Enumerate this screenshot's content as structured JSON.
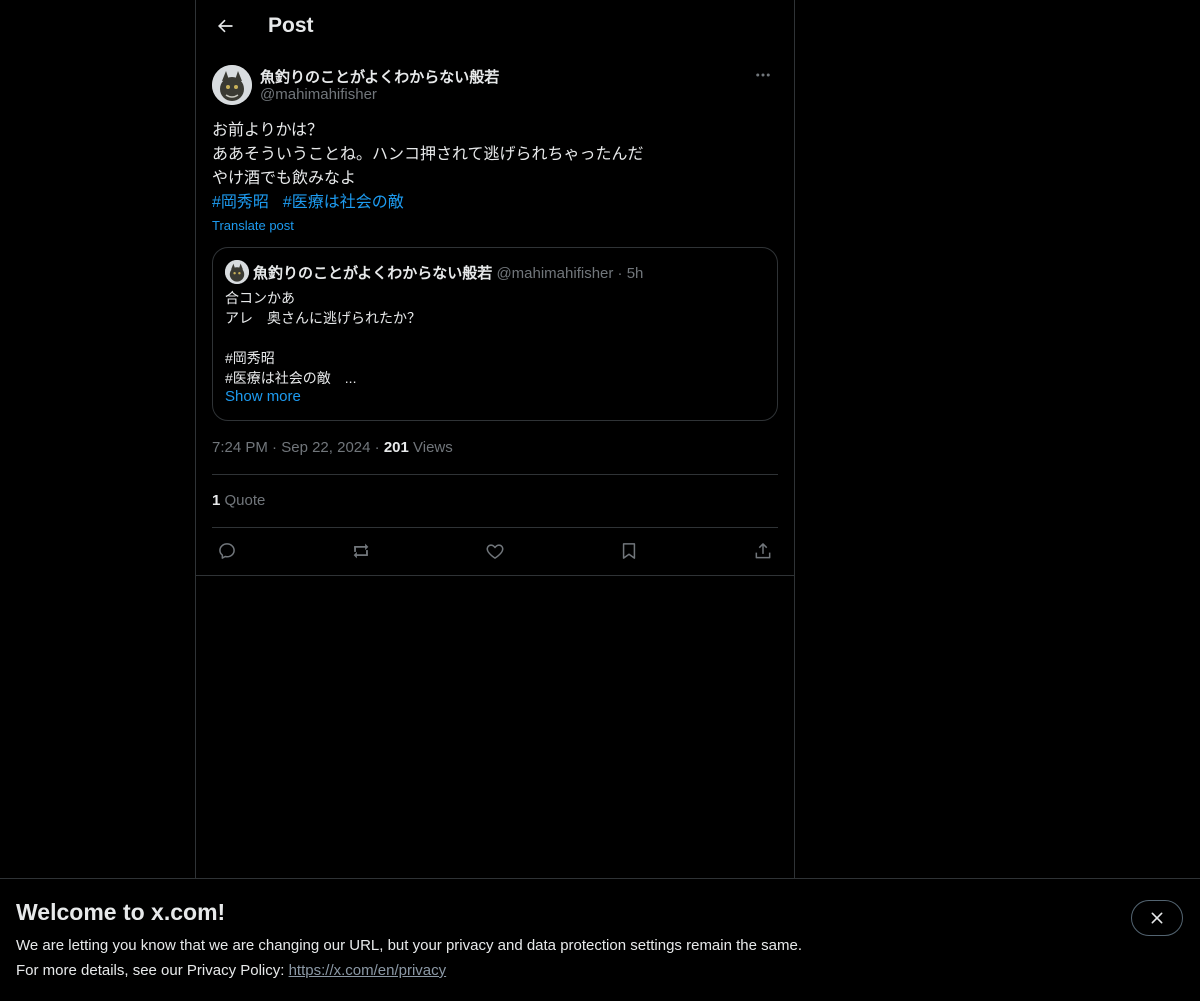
{
  "header": {
    "title": "Post"
  },
  "post": {
    "author_name": "魚釣りのことがよくわからない般若",
    "author_handle": "@mahimahifisher",
    "text_lines": [
      "お前よりかは？",
      "ああそういうことね。ハンコ押されて逃げられちゃったんだ",
      "やけ酒でも飲みなよ"
    ],
    "hashtags": [
      "#岡秀昭",
      "#医療は社会の敵"
    ],
    "translate_label": "Translate post",
    "time": "7:24 PM",
    "date": "Sep 22, 2024",
    "views_count": "201",
    "views_label": "Views",
    "quote_count": "1",
    "quote_label": "Quote"
  },
  "quoted_post": {
    "author_name": "魚釣りのことがよくわからない般若",
    "author_handle": "@mahimahifisher",
    "separator": "·",
    "time_ago": "5h",
    "body_lines": [
      "合コンかあ",
      "アレ　奥さんに逃げられたか？",
      "",
      "#岡秀昭",
      "#医療は社会の敵　..."
    ],
    "show_more": "Show more"
  },
  "meta": {
    "separator": "·"
  },
  "actions": {
    "icons": [
      "reply-icon",
      "repost-icon",
      "like-icon",
      "bookmark-icon",
      "share-icon"
    ]
  },
  "banner": {
    "title": "Welcome to x.com!",
    "line1": "We are letting you know that we are changing our URL, but your privacy and data protection settings remain the same.",
    "line2_prefix": "For more details, see our Privacy Policy: ",
    "link": "https://x.com/en/privacy"
  },
  "colors": {
    "background": "#000000",
    "text": "#e7e9ea",
    "secondary": "#71767b",
    "accent": "#1d9bf0",
    "border": "#2f3336"
  }
}
